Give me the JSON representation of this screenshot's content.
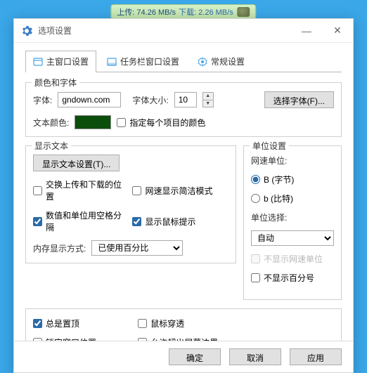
{
  "speed_badge": {
    "upload_label": "上传:",
    "upload_value": "74.26 MB/s",
    "download_label": "下载:",
    "download_value": "2.26 MB/s"
  },
  "window": {
    "title": "选项设置"
  },
  "tabs": {
    "main": "主窗口设置",
    "taskbar": "任务栏窗口设置",
    "general": "常规设置"
  },
  "group_font": {
    "legend": "颜色和字体",
    "font_label": "字体:",
    "font_value": "gndown.com",
    "size_label": "字体大小:",
    "size_value": "10",
    "choose_font_btn": "选择字体(F)...",
    "text_color_label": "文本颜色:",
    "text_color_value": "#0b4d0b",
    "per_item_color": "指定每个项目的颜色"
  },
  "group_display": {
    "legend": "显示文本",
    "display_text_btn": "显示文本设置(T)...",
    "swap_updown": "交换上传和下载的位置",
    "compact_speed": "网速显示简洁模式",
    "space_sep": "数值和单位用空格分隔",
    "mouse_tip": "显示鼠标提示",
    "mem_label": "内存显示方式:",
    "mem_select": "已使用百分比"
  },
  "group_unit": {
    "legend": "单位设置",
    "speed_unit_label": "网速单位:",
    "opt_byte": "B (字节)",
    "opt_bit": "b (比特)",
    "unit_select_label": "单位选择:",
    "unit_select_value": "自动",
    "hide_speed_unit": "不显示网速单位",
    "hide_percent": "不显示百分号"
  },
  "group_bottom": {
    "always_top": "总是置顶",
    "mouse_through": "鼠标穿透",
    "lock_pos": "锁定窗口位置",
    "allow_outside": "允许超出屏幕边界"
  },
  "buttons": {
    "ok": "确定",
    "cancel": "取消",
    "apply": "应用"
  }
}
